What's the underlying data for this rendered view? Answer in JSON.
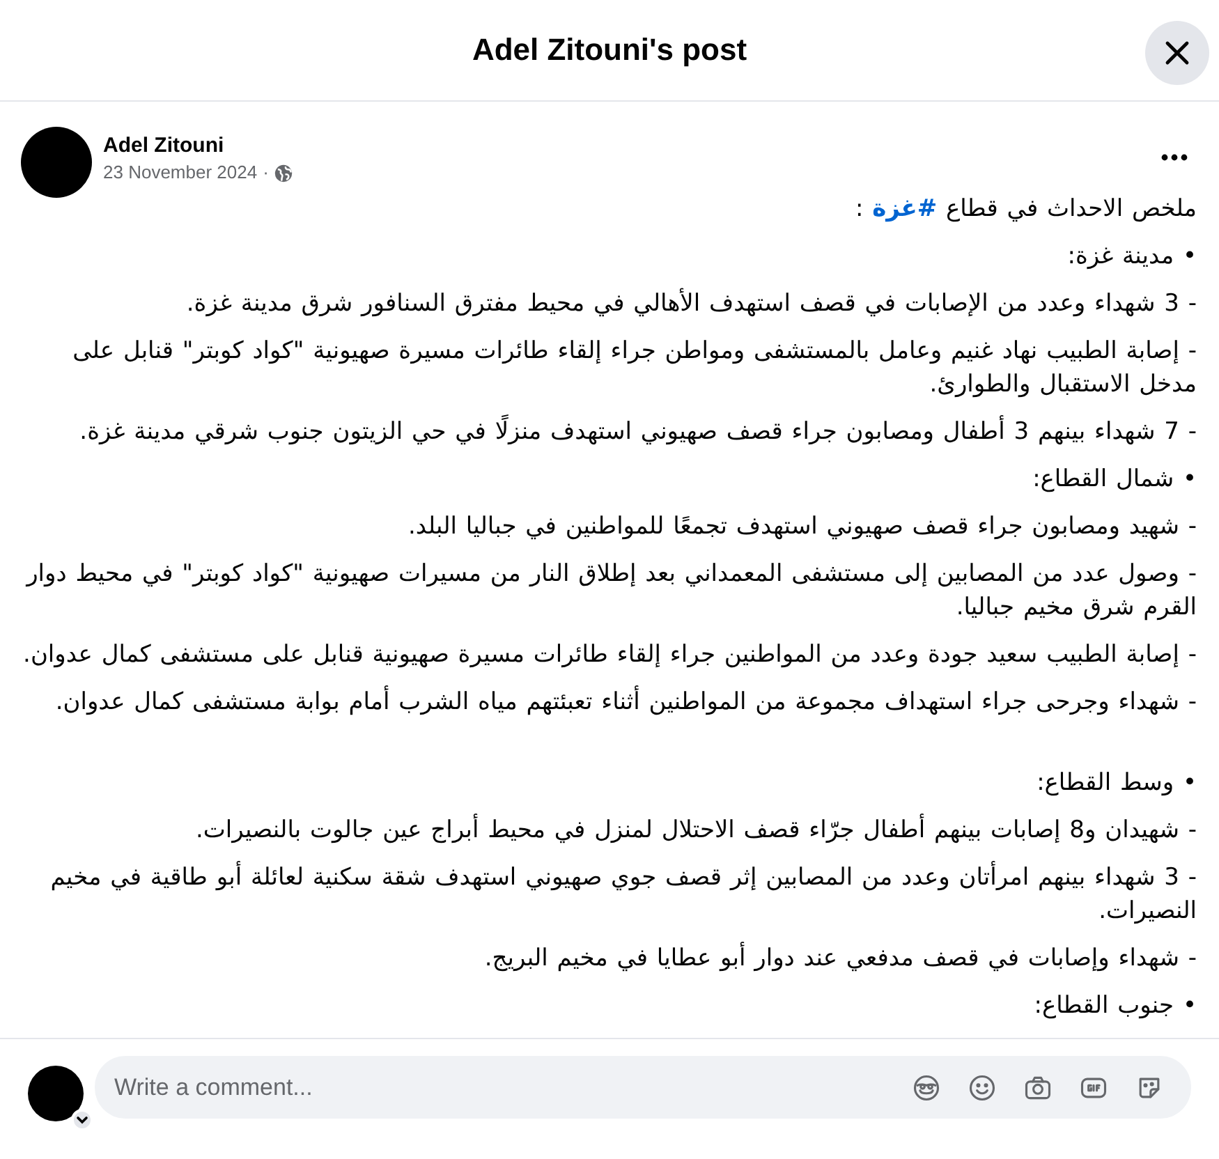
{
  "dialog": {
    "title": "Adel Zitouni's post"
  },
  "post": {
    "author": "Adel Zitouni",
    "date": "23 November 2024",
    "separator": "·",
    "paragraphs": [
      {
        "segments": [
          {
            "kind": "text",
            "text": "ملخص الاحداث في قطاع "
          },
          {
            "kind": "hashtag",
            "text": "#غزة"
          },
          {
            "kind": "text",
            "text": " :"
          }
        ]
      },
      {
        "segments": [
          {
            "kind": "text",
            "text": "• مدينة غزة:"
          }
        ]
      },
      {
        "segments": [
          {
            "kind": "text",
            "text": "- 3 شهداء وعدد من الإصابات في قصف استهدف الأهالي في محيط مفترق السنافور شرق مدينة غزة."
          }
        ]
      },
      {
        "segments": [
          {
            "kind": "text",
            "text": "- إصابة الطبيب نهاد غنيم وعامل بالمستشفى ومواطن جراء إلقاء طائرات مسيرة صهيونية \"كواد كوبتر\" قنابل على مدخل الاستقبال والطوارئ."
          }
        ]
      },
      {
        "segments": [
          {
            "kind": "text",
            "text": "- 7 شهداء بينهم 3 أطفال ومصابون جراء قصف صهيوني استهدف منزلًا في حي الزيتون جنوب شرقي مدينة غزة."
          }
        ]
      },
      {
        "segments": [
          {
            "kind": "text",
            "text": "• شمال القطاع:"
          }
        ]
      },
      {
        "segments": [
          {
            "kind": "text",
            "text": "- شهيد ومصابون جراء قصف صهيوني استهدف تجمعًا للمواطنين في جباليا البلد."
          }
        ]
      },
      {
        "segments": [
          {
            "kind": "text",
            "text": "- وصول عدد من المصابين إلى مستشفى المعمداني بعد إطلاق النار من مسيرات صهيونية \"كواد كوبتر\" في محيط دوار القرم شرق مخيم جباليا."
          }
        ]
      },
      {
        "segments": [
          {
            "kind": "text",
            "text": "- إصابة الطبيب سعيد جودة وعدد من المواطنين جراء إلقاء طائرات مسيرة صهيونية قنابل على مستشفى كمال عدوان."
          }
        ]
      },
      {
        "segments": [
          {
            "kind": "text",
            "text": "- شهداء وجرحى جراء استهداف مجموعة من المواطنين أثناء تعبئتهم مياه الشرب أمام بوابة مستشفى كمال عدوان."
          }
        ]
      },
      {
        "gap_before": true,
        "segments": [
          {
            "kind": "text",
            "text": "• وسط القطاع:"
          }
        ]
      },
      {
        "segments": [
          {
            "kind": "text",
            "text": "- شهيدان و8 إصابات بينهم أطفال جرّاء قصف الاحتلال لمنزل في محيط أبراج عين جالوت بالنصيرات."
          }
        ]
      },
      {
        "segments": [
          {
            "kind": "text",
            "text": "- 3 شهداء بينهم امرأتان وعدد من المصابين إثر قصف جوي صهيوني استهدف شقة سكنية لعائلة أبو طاقية في مخيم النصيرات."
          }
        ]
      },
      {
        "segments": [
          {
            "kind": "text",
            "text": "- شهداء وإصابات في قصف مدفعي عند دوار أبو عطايا في مخيم البريج."
          }
        ]
      },
      {
        "segments": [
          {
            "kind": "text",
            "text": "• جنوب القطاع:"
          }
        ]
      }
    ]
  },
  "comment_box": {
    "placeholder": "Write a comment...",
    "tools": [
      {
        "kind": "avatar"
      },
      {
        "kind": "emoji"
      },
      {
        "kind": "camera"
      },
      {
        "kind": "gif"
      },
      {
        "kind": "sticker"
      }
    ]
  }
}
